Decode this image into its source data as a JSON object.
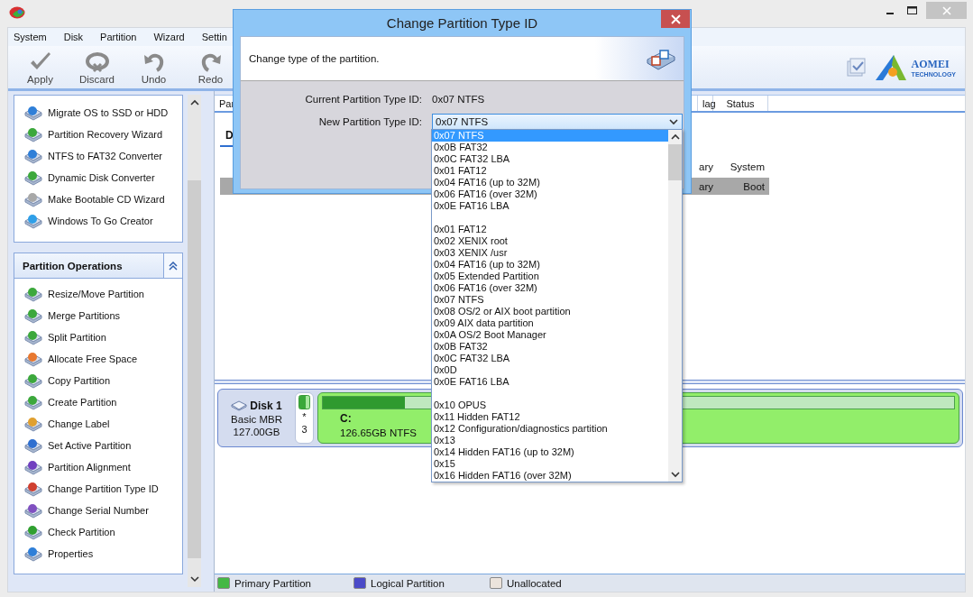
{
  "menu": [
    {
      "label": "System"
    },
    {
      "label": "Disk"
    },
    {
      "label": "Partition"
    },
    {
      "label": "Wizard"
    },
    {
      "label": "Settin"
    }
  ],
  "toolbar": [
    {
      "label": "Apply",
      "kind": "apply"
    },
    {
      "label": "Discard",
      "kind": "discard"
    },
    {
      "label": "Undo",
      "kind": "undo"
    },
    {
      "label": "Redo",
      "kind": "redo"
    }
  ],
  "logo": {
    "name": "AOMEI",
    "tagline": "TECHNOLOGY"
  },
  "wizards": {
    "items": [
      "Migrate OS to SSD or HDD",
      "Partition Recovery Wizard",
      "NTFS to FAT32 Converter",
      "Dynamic Disk Converter",
      "Make Bootable CD Wizard",
      "Windows To Go Creator"
    ]
  },
  "partition_operations": {
    "title": "Partition Operations",
    "expanded": true,
    "items": [
      "Resize/Move Partition",
      "Merge Partitions",
      "Split Partition",
      "Allocate Free Space",
      "Copy Partition",
      "Create Partition",
      "Change Label",
      "Set Active Partition",
      "Partition Alignment",
      "Change Partition Type ID",
      "Change Serial Number",
      "Check Partition",
      "Properties"
    ]
  },
  "partition_table": {
    "columns": [
      "Par",
      "lag",
      "Status"
    ]
  },
  "disk_tab": {
    "label": "D",
    "selected": true
  },
  "inner_table": {
    "columns": [
      "ary",
      "System"
    ],
    "rows": [
      {
        "cells": [
          "ary",
          "Boot"
        ],
        "selected": true
      }
    ]
  },
  "disk_map": {
    "disk": {
      "name": "Disk 1",
      "type": "Basic MBR",
      "size": "127.00GB"
    },
    "small_partition": {
      "flag": "*",
      "number": "3"
    },
    "partitions": [
      {
        "letter": "C:",
        "info": "126.65GB NTFS",
        "level": 0.13
      }
    ]
  },
  "legend": [
    {
      "label": "Primary Partition",
      "color": "#45b845"
    },
    {
      "label": "Logical Partition",
      "color": "#4a4ac8"
    },
    {
      "label": "Unallocated",
      "color": "#ece4dc"
    }
  ],
  "dialog": {
    "title": "Change Partition Type ID",
    "description": "Change type of the partition.",
    "current": {
      "label": "Current Partition Type ID:",
      "value": "0x07 NTFS"
    },
    "new_type": {
      "label": "New Partition Type ID:",
      "value": "0x07 NTFS",
      "expanded": true,
      "option_groups": [
        {
          "options": [
            {
              "text": "0x07 NTFS",
              "selected": true
            },
            {
              "text": "0x0B FAT32",
              "selected": false
            },
            {
              "text": "0x0C FAT32 LBA",
              "selected": false
            },
            {
              "text": "0x01 FAT12",
              "selected": false
            },
            {
              "text": "0x04 FAT16 (up to 32M)",
              "selected": false
            },
            {
              "text": "0x06 FAT16 (over 32M)",
              "selected": false
            },
            {
              "text": "0x0E FAT16 LBA",
              "selected": false
            }
          ]
        },
        {
          "options": [
            {
              "text": "0x01 FAT12",
              "selected": false
            },
            {
              "text": "0x02 XENIX root",
              "selected": false
            },
            {
              "text": "0x03 XENIX /usr",
              "selected": false
            },
            {
              "text": "0x04 FAT16 (up to 32M)",
              "selected": false
            },
            {
              "text": "0x05 Extended Partition",
              "selected": false
            },
            {
              "text": "0x06 FAT16 (over 32M)",
              "selected": false
            },
            {
              "text": "0x07 NTFS",
              "selected": false
            },
            {
              "text": "0x08 OS/2 or AIX boot partition",
              "selected": false
            },
            {
              "text": "0x09 AIX data partition",
              "selected": false
            },
            {
              "text": "0x0A OS/2 Boot Manager",
              "selected": false
            },
            {
              "text": "0x0B FAT32",
              "selected": false
            },
            {
              "text": "0x0C FAT32 LBA",
              "selected": false
            },
            {
              "text": "0x0D",
              "selected": false
            },
            {
              "text": "0x0E FAT16 LBA",
              "selected": false
            }
          ]
        },
        {
          "options": [
            {
              "text": "0x10 OPUS",
              "selected": false
            },
            {
              "text": "0x11 Hidden FAT12",
              "selected": false
            },
            {
              "text": "0x12 Configuration/diagnostics partition",
              "selected": false
            },
            {
              "text": "0x13",
              "selected": false
            },
            {
              "text": "0x14 Hidden FAT16 (up to 32M)",
              "selected": false
            },
            {
              "text": "0x15",
              "selected": false
            },
            {
              "text": "0x16 Hidden FAT16 (over 32M)",
              "selected": false
            }
          ]
        }
      ]
    }
  }
}
